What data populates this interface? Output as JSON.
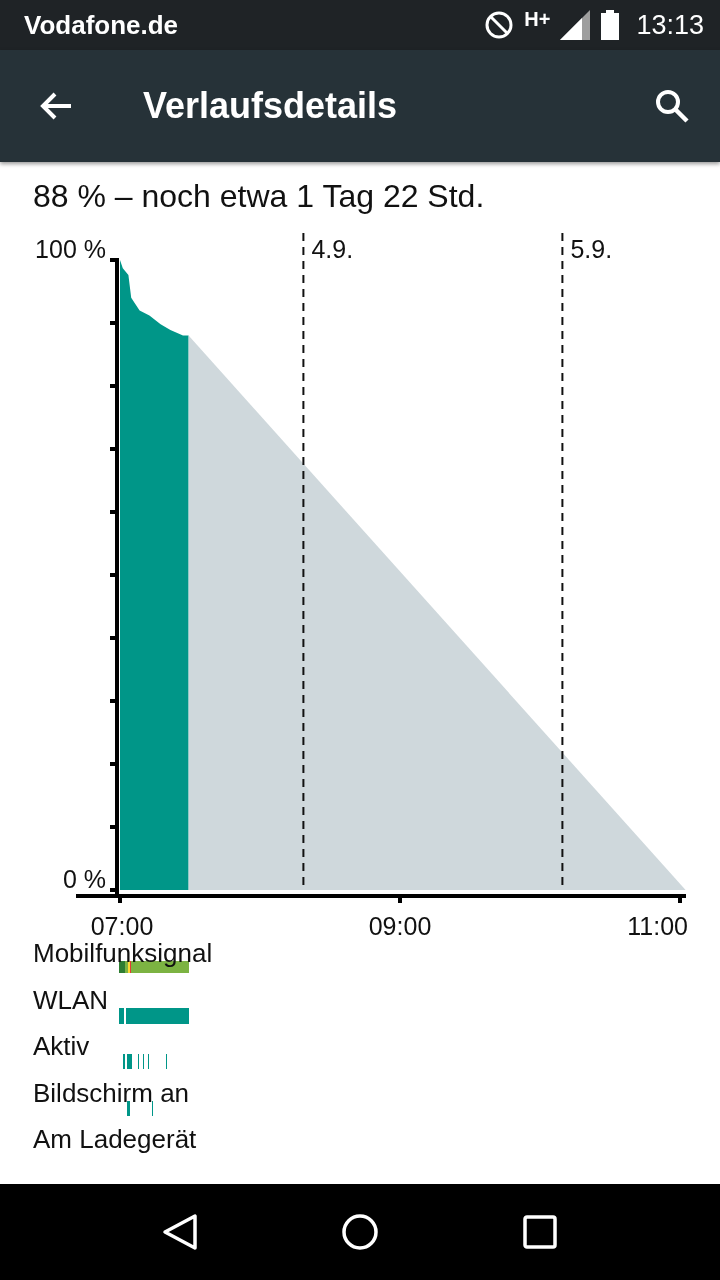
{
  "status_bar": {
    "carrier": "Vodafone.de",
    "network": "H+",
    "time": "13:13"
  },
  "toolbar": {
    "title": "Verlaufsdetails"
  },
  "summary": "88 % – noch etwa 1 Tag 22 Std.",
  "chart": {
    "chart_data": {
      "type": "area",
      "x": [
        7,
        7.02,
        7.06,
        7.08,
        7.14,
        7.21,
        7.29,
        7.36,
        7.45,
        7.49,
        11.04
      ],
      "series": [
        {
          "color": "#009688",
          "values": [
            100,
            98.7,
            97.6,
            94,
            92,
            91.2,
            89.8,
            88.9,
            88,
            88,
            null
          ]
        },
        {
          "color": "#cfd8dc",
          "values": [
            null,
            null,
            null,
            null,
            null,
            null,
            null,
            null,
            null,
            88,
            0
          ]
        }
      ],
      "xlim": [
        7,
        11.04
      ],
      "ylim": [
        0,
        100
      ],
      "xticks": [
        {
          "value": 7,
          "label": "07:00"
        },
        {
          "value": 9,
          "label": "09:00"
        },
        {
          "value": 11,
          "label": "11:00"
        }
      ],
      "yticks": [
        {
          "value": 0,
          "label": "0 %"
        },
        {
          "value": 100,
          "label": "100 %"
        }
      ],
      "ref_lines": [
        {
          "axis": "x",
          "value": 8.31
        },
        {
          "axis": "x",
          "value": 10.16
        }
      ],
      "annotations": [
        "4.9.",
        "5.9."
      ]
    }
  },
  "lanes": [
    {
      "label": "Mobilfunksignal",
      "kind": "signal"
    },
    {
      "label": "WLAN",
      "kind": "solid"
    },
    {
      "label": "Aktiv",
      "kind": "pulses"
    },
    {
      "label": "Bildschirm an",
      "kind": "pulses"
    },
    {
      "label": "Am Ladegerät",
      "kind": "none"
    }
  ]
}
